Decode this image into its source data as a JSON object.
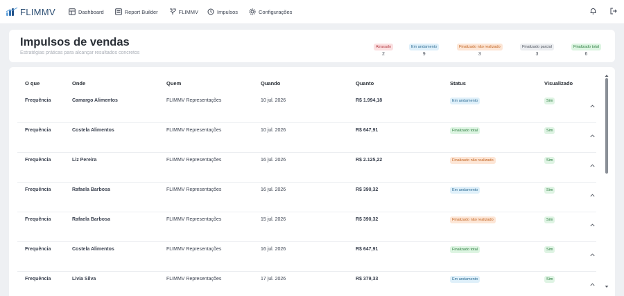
{
  "app": {
    "logo_text": "FLIMMV",
    "colors": {
      "brand": "#2b4d72",
      "accent": "#2f6fb0"
    }
  },
  "nav": {
    "items": [
      {
        "label": "Dashboard",
        "icon": "dashboard-icon"
      },
      {
        "label": "Report Builder",
        "icon": "report-icon"
      },
      {
        "label": "FLIMMV",
        "icon": "flimmv-icon"
      },
      {
        "label": "Impulsos",
        "icon": "history-icon"
      },
      {
        "label": "Configurações",
        "icon": "gear-icon"
      }
    ],
    "right_icons": [
      "bell-icon",
      "logout-icon"
    ]
  },
  "header": {
    "title": "Impulsos de vendas",
    "subtitle": "Estratégias práticas para alcançar resultados concretos",
    "statuses": [
      {
        "label": "Atrasado",
        "count": "2",
        "color": "red"
      },
      {
        "label": "Em andamento",
        "count": "9",
        "color": "blue"
      },
      {
        "label": "Finalizado não realizado",
        "count": "3",
        "color": "orange"
      },
      {
        "label": "Finalizado parcial",
        "count": "3",
        "color": "gray"
      },
      {
        "label": "Finalizado total",
        "count": "6",
        "color": "green"
      }
    ]
  },
  "table": {
    "columns": [
      "O que",
      "Onde",
      "Quem",
      "Quando",
      "Quanto",
      "Status",
      "Visualizado"
    ],
    "rows": [
      {
        "what": "Frequência",
        "where": "Camargo Alimentos",
        "who": "FLIMMV Representações",
        "when": "10 jul. 2026",
        "amount": "R$ 1.994,18",
        "status": "Em andamento",
        "status_color": "blue",
        "viewed": "Sim"
      },
      {
        "what": "Frequência",
        "where": "Costela Alimentos",
        "who": "FLIMMV Representações",
        "when": "10 jul. 2026",
        "amount": "R$ 647,91",
        "status": "Finalizado total",
        "status_color": "green",
        "viewed": "Sim"
      },
      {
        "what": "Frequência",
        "where": "Liz Pereira",
        "who": "FLIMMV Representações",
        "when": "16 jul. 2026",
        "amount": "R$ 2.125,22",
        "status": "Finalizado não realizado",
        "status_color": "orange",
        "viewed": "Sim"
      },
      {
        "what": "Frequência",
        "where": "Rafaela Barbosa",
        "who": "FLIMMV Representações",
        "when": "16 jul. 2026",
        "amount": "R$ 390,32",
        "status": "Em andamento",
        "status_color": "blue",
        "viewed": "Sim"
      },
      {
        "what": "Frequência",
        "where": "Rafaela Barbosa",
        "who": "FLIMMV Representações",
        "when": "15 jul. 2026",
        "amount": "R$ 390,32",
        "status": "Finalizado não realizado",
        "status_color": "orange",
        "viewed": "Sim"
      },
      {
        "what": "Frequência",
        "where": "Costela Alimentos",
        "who": "FLIMMV Representações",
        "when": "16 jul. 2026",
        "amount": "R$ 647,91",
        "status": "Finalizado total",
        "status_color": "green",
        "viewed": "Sim"
      },
      {
        "what": "Frequência",
        "where": "Livia Silva",
        "who": "FLIMMV Representações",
        "when": "17 jul. 2026",
        "amount": "R$ 379,33",
        "status": "Em andamento",
        "status_color": "blue",
        "viewed": "Sim"
      }
    ]
  }
}
